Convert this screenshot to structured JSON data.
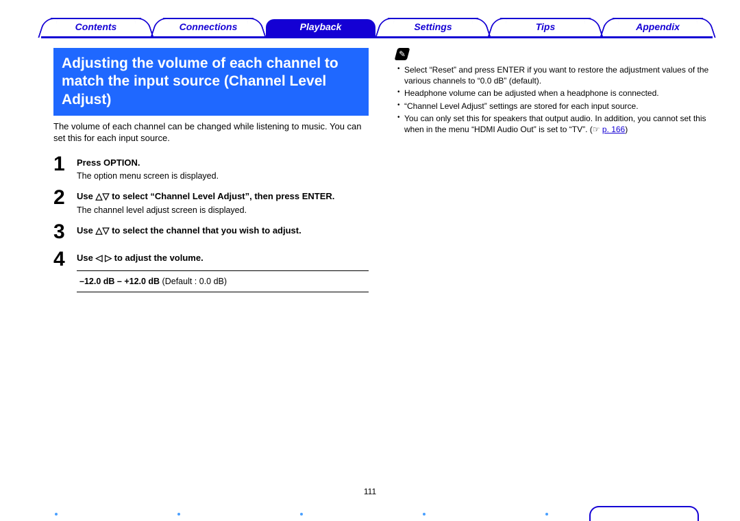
{
  "nav": {
    "tabs": [
      {
        "label": "Contents",
        "active": false
      },
      {
        "label": "Connections",
        "active": false
      },
      {
        "label": "Playback",
        "active": true
      },
      {
        "label": "Settings",
        "active": false
      },
      {
        "label": "Tips",
        "active": false
      },
      {
        "label": "Appendix",
        "active": false
      }
    ]
  },
  "heading": "Adjusting the volume of each channel to match the input source (Channel Level Adjust)",
  "intro": "The volume of each channel can be changed while listening to music. You can set this for each input source.",
  "steps": [
    {
      "num": "1",
      "title": "Press OPTION.",
      "desc": "The option menu screen is displayed."
    },
    {
      "num": "2",
      "title": "Use △▽ to select “Channel Level Adjust”, then press ENTER.",
      "desc": "The channel level adjust screen is displayed."
    },
    {
      "num": "3",
      "title": "Use △▽ to select the channel that you wish to adjust.",
      "desc": ""
    },
    {
      "num": "4",
      "title": "Use ◁ ▷ to adjust the volume.",
      "desc": ""
    }
  ],
  "range": {
    "bold": "–12.0 dB – +12.0 dB",
    "rest": " (Default : 0.0 dB)"
  },
  "note_icon": "✎",
  "notes": [
    "Select “Reset” and press ENTER if you want to restore the adjustment values of the various channels to “0.0 dB” (default).",
    "Headphone volume can be adjusted when a headphone is connected.",
    "“Channel Level Adjust” settings are stored for each input source.",
    "You can only set this for speakers that output audio. In addition, you cannot set this when in the menu “HDMI Audio Out” is set to “TV”. (☞ "
  ],
  "note_link": "p. 166",
  "note_tail": ")",
  "page_number": "111"
}
